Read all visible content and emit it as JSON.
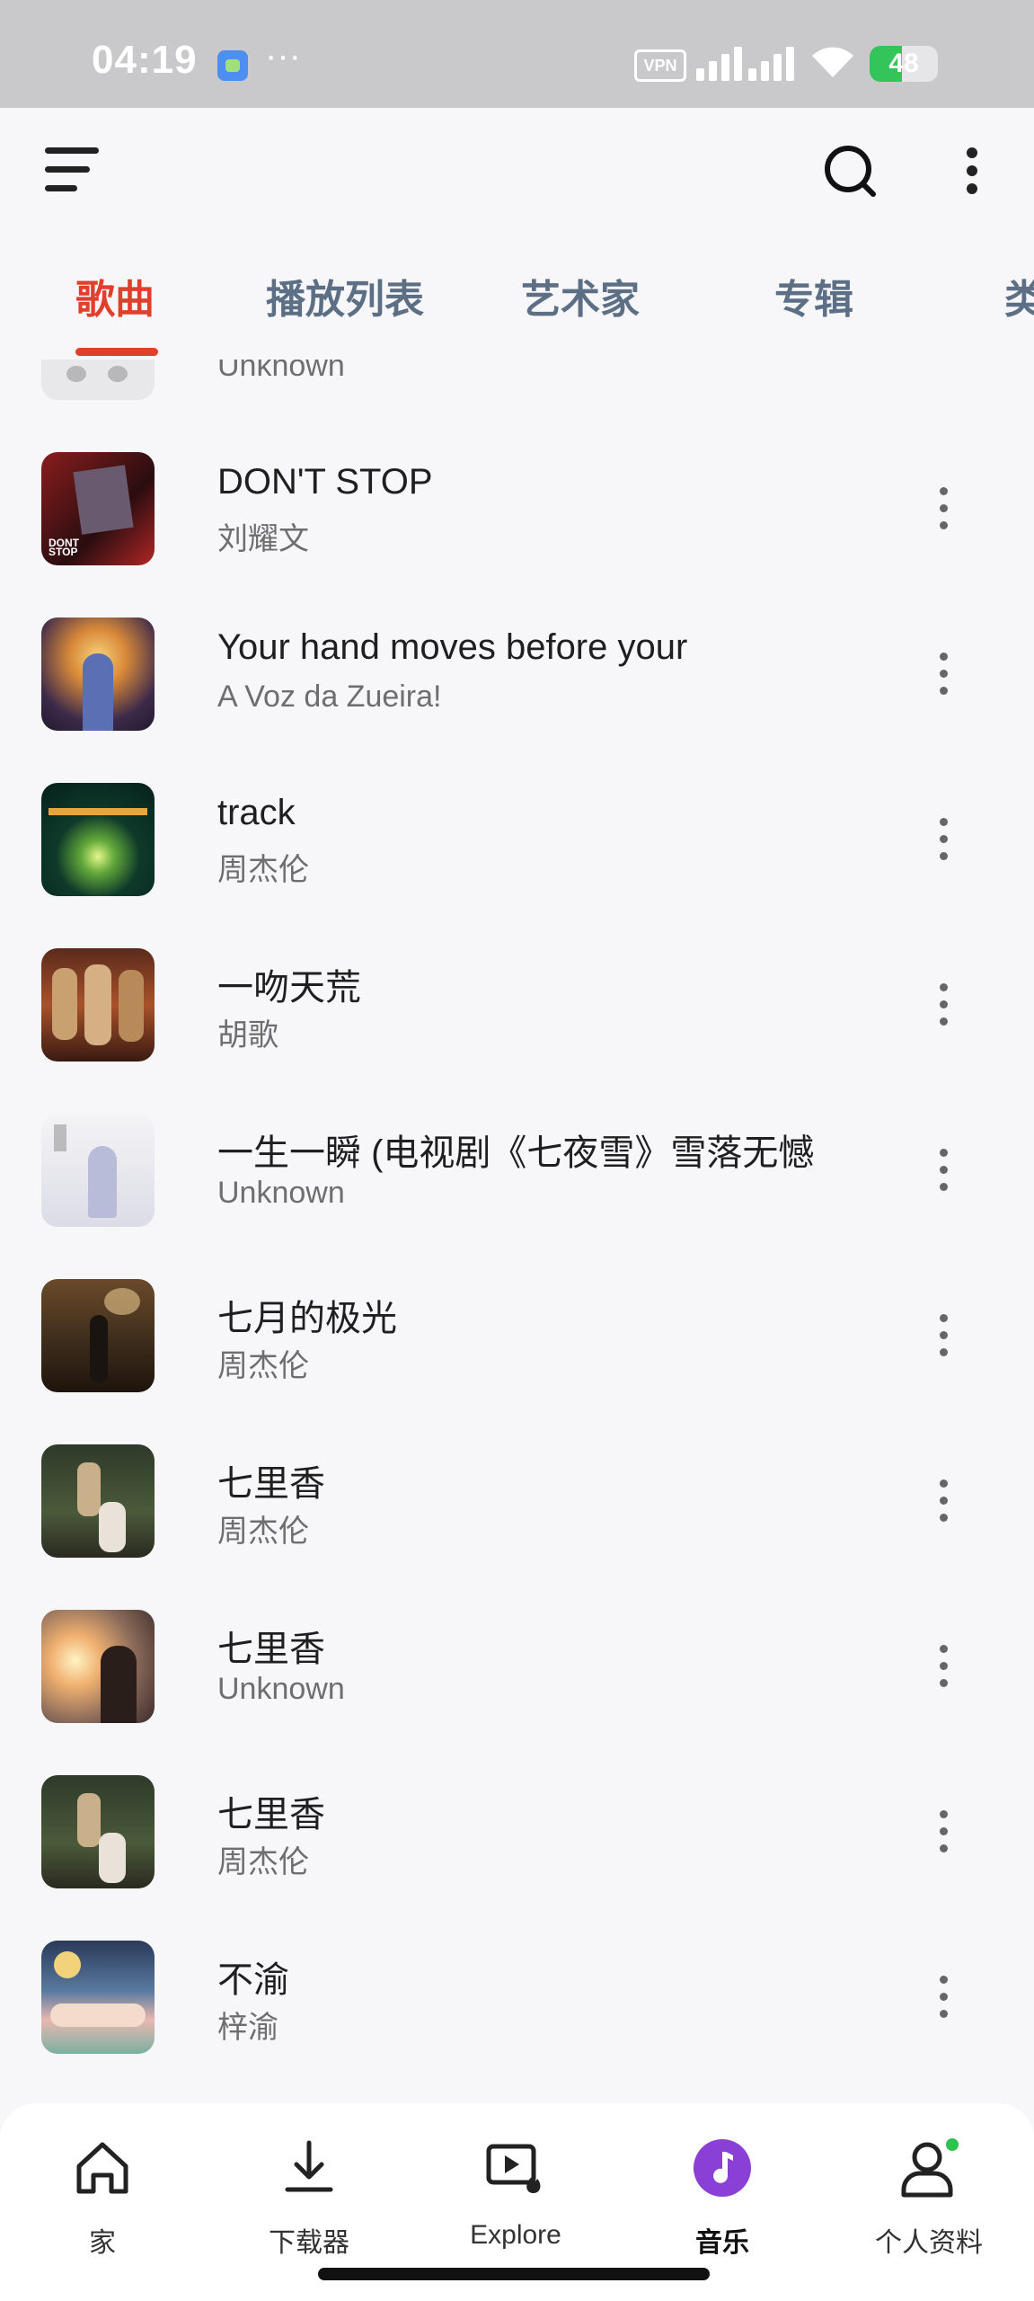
{
  "status_bar": {
    "time": "04:19",
    "more_indicator": "···",
    "vpn_label": "VPN",
    "battery": "48",
    "battery_level": 0.48,
    "battery_color": "#33c45a"
  },
  "app_bar": {
    "menu_icon": "menu-icon",
    "search_icon": "search-icon",
    "more_icon": "more-vertical-icon"
  },
  "tabs": [
    {
      "label": "歌曲",
      "active": true
    },
    {
      "label": "播放列表",
      "active": false
    },
    {
      "label": "艺术家",
      "active": false
    },
    {
      "label": "专辑",
      "active": false
    },
    {
      "label": "类",
      "active": false
    }
  ],
  "accent_color": "#e0402b",
  "songs": [
    {
      "title": "",
      "artist": "Unknown"
    },
    {
      "title": "DON'T STOP",
      "artist": "刘耀文"
    },
    {
      "title": "Your hand moves before your",
      "artist": "A Voz da Zueira!"
    },
    {
      "title": "track",
      "artist": "周杰伦"
    },
    {
      "title": "一吻天荒",
      "artist": "胡歌"
    },
    {
      "title": "一生一瞬 (电视剧《七夜雪》雪落无憾",
      "artist": "Unknown"
    },
    {
      "title": "七月的极光",
      "artist": "周杰伦"
    },
    {
      "title": "七里香",
      "artist": "周杰伦"
    },
    {
      "title": "七里香",
      "artist": "Unknown"
    },
    {
      "title": "七里香",
      "artist": "周杰伦"
    },
    {
      "title": "不渝",
      "artist": "梓渝"
    }
  ],
  "bottom_nav": [
    {
      "label": "家",
      "icon": "home-icon",
      "active": false
    },
    {
      "label": "下载器",
      "icon": "download-icon",
      "active": false
    },
    {
      "label": "Explore",
      "icon": "explore-icon",
      "active": false
    },
    {
      "label": "音乐",
      "icon": "music-note-icon",
      "active": true
    },
    {
      "label": "个人资料",
      "icon": "profile-icon",
      "active": false
    }
  ]
}
